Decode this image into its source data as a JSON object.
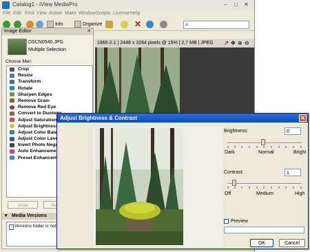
{
  "app": {
    "title": "Catalog1 - iView MediaPro"
  },
  "menu": [
    "File",
    "Edit",
    "Find",
    "View",
    "Action",
    "Make",
    "Window",
    "Scripts",
    "License",
    "Help"
  ],
  "toolbar": {
    "info_label": "Info",
    "organize_label": "Organize"
  },
  "editor": {
    "header": "Image Editor",
    "file_name": "DSCN0540.JPG",
    "selection": "Multiple Selection",
    "filter_caption": "Choose filter:",
    "filters": [
      "Crop",
      "Resize",
      "Transform",
      "Rotate",
      "Sharpen Edges",
      "Remove Grain",
      "Remove Red Eye",
      "Convert to Duotone",
      "Adjust Saturation",
      "Adjust Brightness",
      "Adjust Color Balance",
      "Adjust Color Levels",
      "Invert Photo Negative",
      "Auto Enhancement",
      "Preset Enhancement"
    ],
    "undo_label": "Undo",
    "revert_label": "Rever",
    "versions_header": "Media Versions",
    "versions_text": "Versions folder is not se"
  },
  "viewer": {
    "info": "1966-2.1 | 2448 x 3264 pixels @ 15% | 2,7 MB | JPEG"
  },
  "dialog": {
    "title": "Adjust Brightness & Contrast",
    "brightness_label": "Brightness:",
    "brightness_value": "0",
    "brightness_marks": [
      "Dark",
      "Normal",
      "Bright"
    ],
    "contrast_label": "Contrast:",
    "contrast_value": "1",
    "contrast_marks": [
      "Off",
      "Medium",
      "High"
    ],
    "preview_label": "Preview",
    "ok_label": "OK",
    "cancel_label": "Cancel"
  }
}
